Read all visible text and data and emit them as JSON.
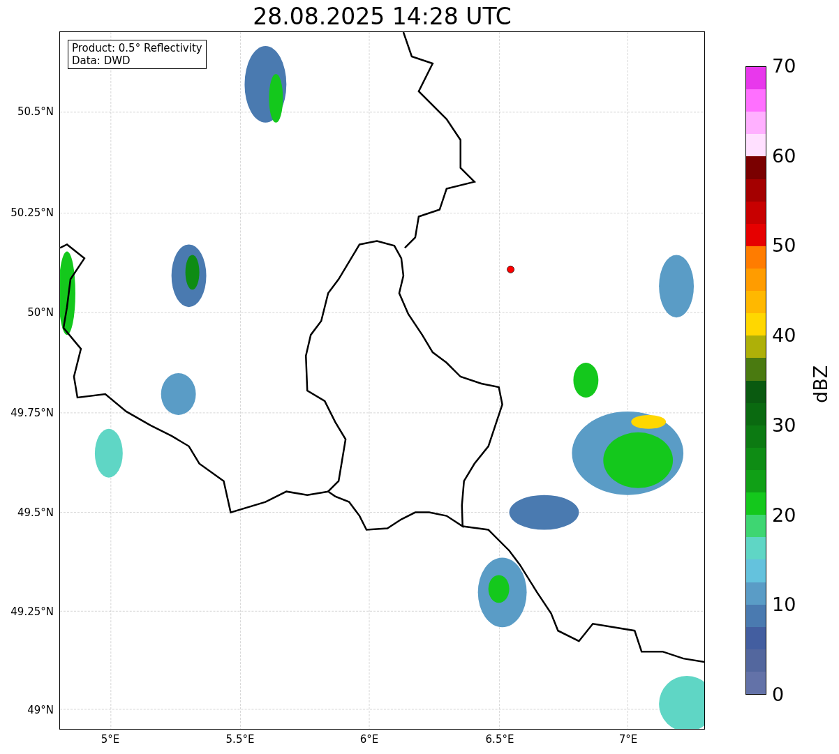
{
  "title": "28.08.2025 14:28 UTC",
  "map": {
    "legend": [
      "Product: 0.5° Reflectivity",
      "Data: DWD"
    ],
    "lat_labels": [
      "50.5°N",
      "50.25°N",
      "50°N",
      "49.75°N",
      "49.5°N",
      "49.25°N",
      "49°N"
    ],
    "lon_labels": [
      "5°E",
      "5.5°E",
      "6°E",
      "6.5°E",
      "7°E"
    ]
  },
  "colorbar": {
    "label": "dBZ",
    "ticks": [
      "70",
      "60",
      "50",
      "40",
      "30",
      "20",
      "10",
      "0"
    ],
    "segments": [
      {
        "color": "#6372a8"
      },
      {
        "color": "#53679e"
      },
      {
        "color": "#435ea0"
      },
      {
        "color": "#4a7ab0"
      },
      {
        "color": "#5a9cc6"
      },
      {
        "color": "#64c2dd"
      },
      {
        "color": "#5fd6c5"
      },
      {
        "color": "#3ed672"
      },
      {
        "color": "#14c81c"
      },
      {
        "color": "#10a016"
      },
      {
        "color": "#0e8c14"
      },
      {
        "color": "#0c7a12"
      },
      {
        "color": "#0a6a10"
      },
      {
        "color": "#0a5a10"
      },
      {
        "color": "#4a7a10"
      },
      {
        "color": "#aeb008"
      },
      {
        "color": "#ffd700"
      },
      {
        "color": "#ffb800"
      },
      {
        "color": "#ff9c00"
      },
      {
        "color": "#ff7c00"
      },
      {
        "color": "#e60000"
      },
      {
        "color": "#c80000"
      },
      {
        "color": "#a40000"
      },
      {
        "color": "#7a0000"
      },
      {
        "color": "#ffe0ff"
      },
      {
        "color": "#ffb0ff"
      },
      {
        "color": "#ff70ff"
      },
      {
        "color": "#e838ec"
      }
    ]
  }
}
